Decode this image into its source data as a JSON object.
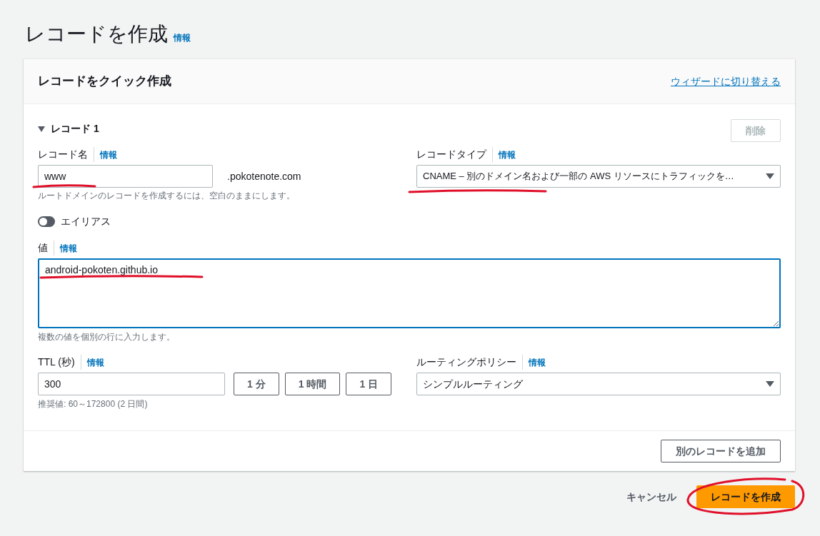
{
  "page": {
    "title": "レコードを作成",
    "info": "情報"
  },
  "card": {
    "title": "レコードをクイック作成",
    "wizard_link": "ウィザードに切り替える"
  },
  "record": {
    "title": "レコード 1",
    "expanded": true,
    "delete_button": {
      "label": "削除",
      "disabled": true
    },
    "record_name": {
      "label": "レコード名",
      "info": "情報",
      "value": "www",
      "suffix": ".pokotenote.com",
      "hint": "ルートドメインのレコードを作成するには、空白のままにします。"
    },
    "record_type": {
      "label": "レコードタイプ",
      "info": "情報",
      "value": "CNAME – 別のドメイン名および一部の AWS リソースにトラフィックを…"
    },
    "alias": {
      "label": "エイリアス",
      "on": false
    },
    "value": {
      "label": "値",
      "info": "情報",
      "value": "android-pokoten.github.io",
      "focused": true,
      "hint": "複数の値を個別の行に入力します。"
    },
    "ttl": {
      "label": "TTL (秒)",
      "info": "情報",
      "value": "300",
      "presets": [
        "1 分",
        "1 時間",
        "1 日"
      ],
      "hint": "推奨値: 60～172800 (2 日間)"
    },
    "routing_policy": {
      "label": "ルーティングポリシー",
      "info": "情報",
      "value": "シンプルルーティング"
    }
  },
  "add_button": "別のレコードを追加",
  "footer": {
    "cancel": "キャンセル",
    "create": "レコードを作成"
  }
}
